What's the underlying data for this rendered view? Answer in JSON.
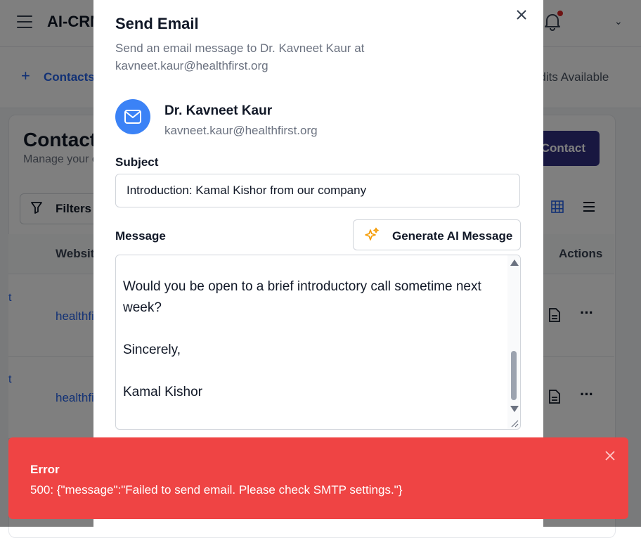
{
  "app": {
    "brand": "AI-CRM",
    "nav_link": "Contacts",
    "credits": "Credits Available",
    "page_title": "Contacts",
    "page_subtitle": "Manage your contacts",
    "add_button": "Add Contact",
    "filters_label": "Filters",
    "columns": {
      "website": "Website",
      "actions": "Actions"
    },
    "rows": [
      {
        "prefix": "t",
        "website": "healthfirst.org"
      },
      {
        "prefix": "t",
        "website": "healthfirst.org"
      }
    ]
  },
  "modal": {
    "title": "Send Email",
    "description": "Send an email message to Dr. Kavneet Kaur at kavneet.kaur@healthfirst.org",
    "recipient_name": "Dr. Kavneet Kaur",
    "recipient_email": "kavneet.kaur@healthfirst.org",
    "subject_label": "Subject",
    "subject_value": "Introduction: Kamal Kishor from our company",
    "message_label": "Message",
    "generate_button": "Generate AI Message",
    "message_lines": {
      "p1": "Would you be open to a brief introductory call sometime next week?",
      "p2": "Sincerely,",
      "p3": "Kamal Kishor"
    }
  },
  "toast": {
    "title": "Error",
    "message": "500: {\"message\":\"Failed to send email. Please check SMTP settings.\"}",
    "color": "#ef4444"
  },
  "icons": [
    "menu-icon",
    "bell-icon",
    "chevron-down-icon",
    "plus-icon",
    "filter-icon",
    "grid-view-icon",
    "list-view-icon",
    "document-icon",
    "more-icon",
    "close-icon",
    "mail-icon",
    "sparkle-icon",
    "resize-handle-icon"
  ],
  "colors": {
    "accent": "#3b82f6",
    "primary_dark": "#312e81",
    "link": "#2563eb",
    "error": "#ef4444"
  }
}
